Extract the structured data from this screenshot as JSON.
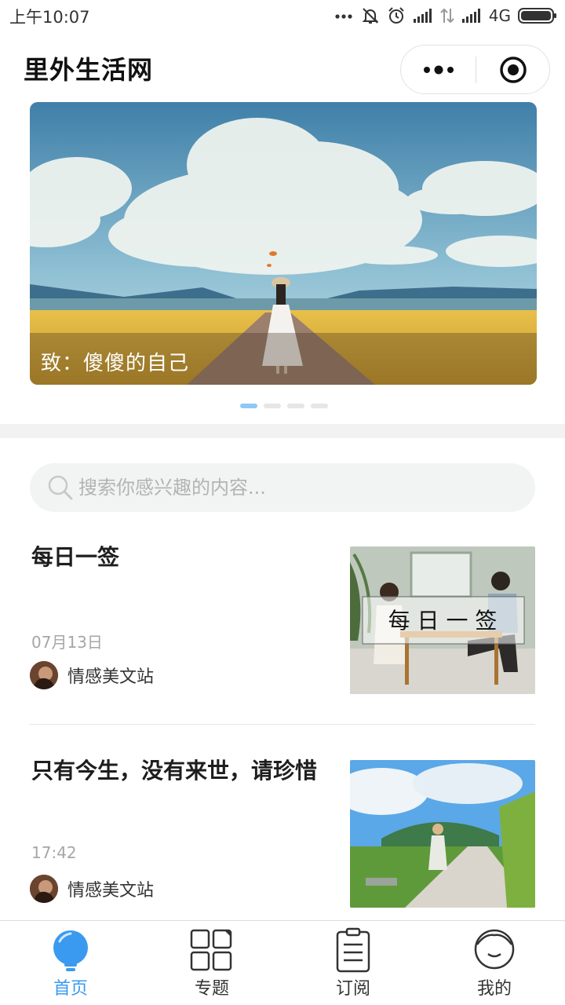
{
  "status_bar": {
    "time": "上午10:07",
    "network": "4G",
    "icons": [
      "more-dots-icon",
      "mute-bell-icon",
      "alarm-icon",
      "signal-icon",
      "data-transfer-icon",
      "signal-icon",
      "battery-icon"
    ]
  },
  "header": {
    "title": "里外生活网",
    "capsule_icons": [
      "more-icon",
      "close-target-icon"
    ]
  },
  "banner": {
    "caption": "致：傻傻的自己",
    "slide_count": 4,
    "active_slide": 0
  },
  "search": {
    "placeholder": "搜索你感兴趣的内容..."
  },
  "articles": [
    {
      "title": "每日一签",
      "date": "07月13日",
      "author": "情感美文站",
      "thumb_text": "每 日 一 签"
    },
    {
      "title": "只有今生，没有来世，请珍惜",
      "date": "17:42",
      "author": "情感美文站"
    }
  ],
  "tabbar": {
    "active": 0,
    "tabs": [
      {
        "label": "首页",
        "icon": "lightbulb-icon"
      },
      {
        "label": "专题",
        "icon": "grid-icon"
      },
      {
        "label": "订阅",
        "icon": "clipboard-icon"
      },
      {
        "label": "我的",
        "icon": "profile-icon"
      }
    ]
  },
  "colors": {
    "accent": "#3a9af0",
    "active_dot": "#8fc8f5"
  }
}
